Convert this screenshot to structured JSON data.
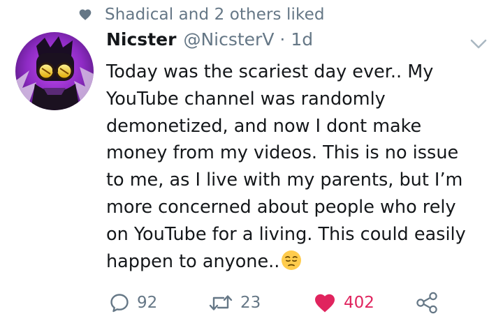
{
  "social_context": {
    "icon": "heart-icon",
    "text": "Shadical and 2 others liked"
  },
  "tweet": {
    "author_name": "Nicster",
    "handle": "@NicsterV",
    "separator": "·",
    "time": "1d",
    "avatar_icon": "avatar-image",
    "text_lines": [
      "Today was the scariest day ever.. My",
      "YouTube channel was randomly",
      "demonetized, and now I dont make",
      "money from my videos. This is no issue",
      "to me, as I live with my parents, but I’m",
      "more concerned about people who rely",
      "on YouTube for a living. This could easily",
      "happen to anyone.."
    ],
    "end_emoji": "pensive-face-emoji"
  },
  "actions": {
    "replies": "92",
    "retweets": "23",
    "likes": "402",
    "share_icon": "share-icon"
  },
  "colors": {
    "text": "#14171a",
    "muted": "#657786",
    "like": "#e0245e"
  }
}
